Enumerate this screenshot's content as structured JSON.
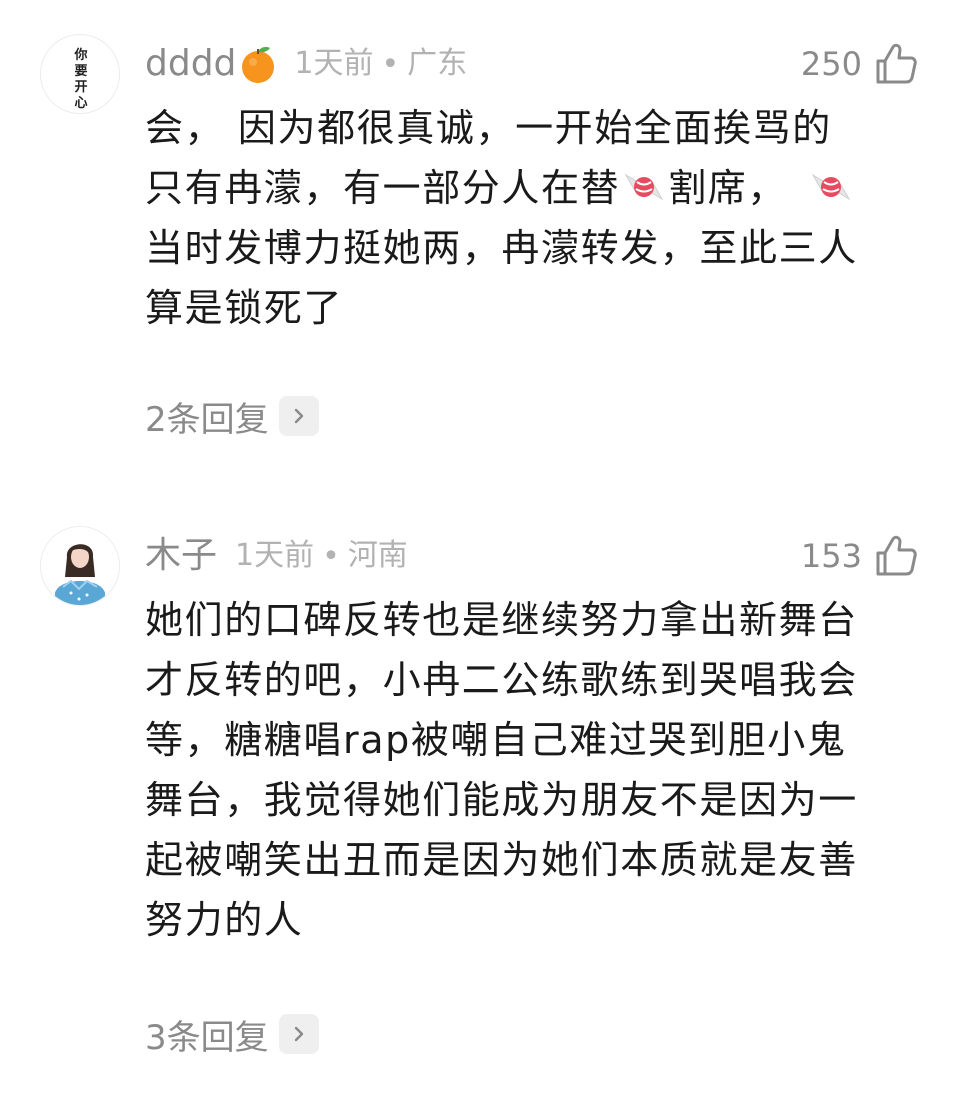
{
  "comments": [
    {
      "avatar_text": "你要开心",
      "username": "dddd",
      "username_emoji": "tangerine-emoji",
      "time": "1天前",
      "location": "广东",
      "likes": "250",
      "text_parts": {
        "line1": "会， 因为都很真诚，一开始全面挨骂的",
        "line2a": "只有冉濛，有一部分人在替",
        "line2b": "割席，",
        "line3": "当时发博力挺她两，冉濛转发，至此三人",
        "line4": "算是锁死了"
      },
      "replies": "2条回复"
    },
    {
      "username": "木子",
      "time": "1天前",
      "location": "河南",
      "likes": "153",
      "lines": [
        "她们的口碑反转也是继续努力拿出新舞台",
        "才反转的吧，小冉二公练歌练到哭唱我会",
        "等，糖糖唱rap被嘲自己难过哭到胆小鬼",
        "舞台，我觉得她们能成为朋友不是因为一",
        "起被嘲笑出丑而是因为她们本质就是友善",
        "努力的人"
      ],
      "replies": "3条回复"
    }
  ],
  "icons": {
    "like": "thumbs-up-icon",
    "chevron": "chevron-right-icon",
    "candy": "candy-emoji"
  }
}
